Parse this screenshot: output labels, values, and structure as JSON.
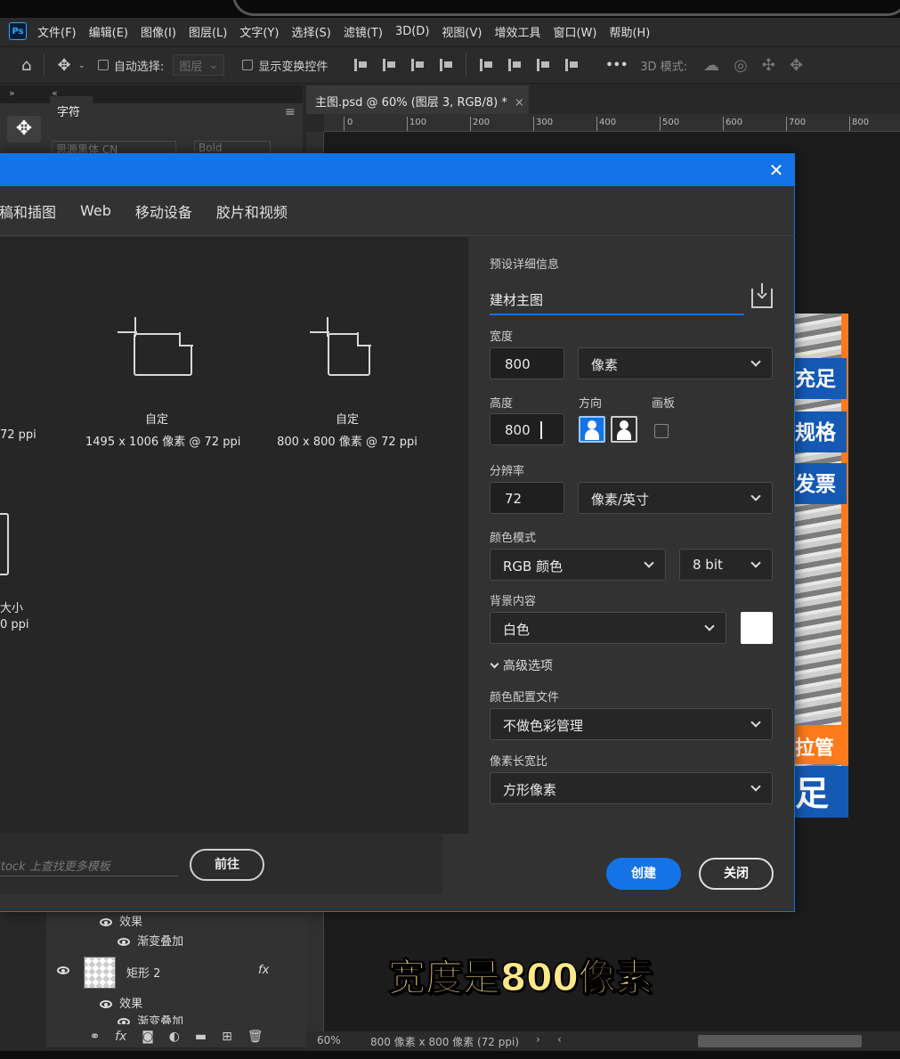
{
  "menubar": {
    "logo": "Ps",
    "items": [
      "文件(F)",
      "编辑(E)",
      "图像(I)",
      "图层(L)",
      "文字(Y)",
      "选择(S)",
      "滤镜(T)",
      "3D(D)",
      "视图(V)",
      "增效工具",
      "窗口(W)",
      "帮助(H)"
    ]
  },
  "options_bar": {
    "auto_select_label": "自动选择:",
    "auto_select_target": "图层",
    "show_transform_label": "显示变换控件",
    "more": "•••",
    "mode_3d_label": "3D 模式:"
  },
  "panel": {
    "collapse_left": "»",
    "collapse_right": "«",
    "character_tab": "字符",
    "font_family": "思源黑体 CN",
    "font_weight": "Bold"
  },
  "document_tab": {
    "title": "主图.psd @ 60% (图层 3, RGB/8) *",
    "close": "×"
  },
  "ruler_labels": [
    "0",
    "100",
    "200",
    "300",
    "400",
    "500",
    "600",
    "700",
    "800"
  ],
  "banner": {
    "tag1": "充足",
    "tag2": "规格",
    "tag3": "发票",
    "tag4": "拉管",
    "tag5": "足"
  },
  "dialog": {
    "close": "✕",
    "tabs": [
      "图稿和插图",
      "Web",
      "移动设备",
      "胶片和视频"
    ],
    "presets": [
      {
        "name": "自定",
        "size": "1495 x 1006 像素 @ 72 ppi"
      },
      {
        "name": "自定",
        "size": "800 x 800 像素 @ 72 ppi"
      }
    ],
    "partial_left_1": "72 ppi",
    "partial_left_name": "大小",
    "partial_left_size": "0 ppi",
    "search_placeholder": "在 Adobe Stock 上查找更多模板",
    "goto_button": "前往",
    "details": {
      "section_label": "预设详细信息",
      "preset_name": "建材主图",
      "width_label": "宽度",
      "width_value": "800",
      "width_unit": "像素",
      "height_label": "高度",
      "height_value": "800",
      "orientation_label": "方向",
      "artboard_label": "画板",
      "resolution_label": "分辨率",
      "resolution_value": "72",
      "resolution_unit": "像素/英寸",
      "color_mode_label": "颜色模式",
      "color_mode": "RGB 颜色",
      "bit_depth": "8 bit",
      "background_label": "背景内容",
      "background_value": "白色",
      "background_color": "#ffffff",
      "advanced_label": "高级选项",
      "color_profile_label": "颜色配置文件",
      "color_profile": "不做色彩管理",
      "pixel_aspect_label": "像素长宽比",
      "pixel_aspect": "方形像素"
    },
    "create_button": "创建",
    "close_button": "关闭"
  },
  "layers": {
    "effects_label": "效果",
    "gradient_label": "渐变叠加",
    "layer_name": "矩形 2",
    "fx": "fx",
    "effects_label_2": "效果",
    "gradient_label_2": "渐变叠加"
  },
  "status_bar": {
    "zoom": "60%",
    "doc_info": "800 像素 x 800 像素 (72 ppi)",
    "arrow_right": "›",
    "arrow_left": "‹"
  },
  "subtitle": "宽度是800像素",
  "colors": {
    "accent": "#1473e6",
    "banner_orange": "#ff7a1a",
    "banner_blue": "#1459b4",
    "subtitle": "#ffe88a"
  }
}
